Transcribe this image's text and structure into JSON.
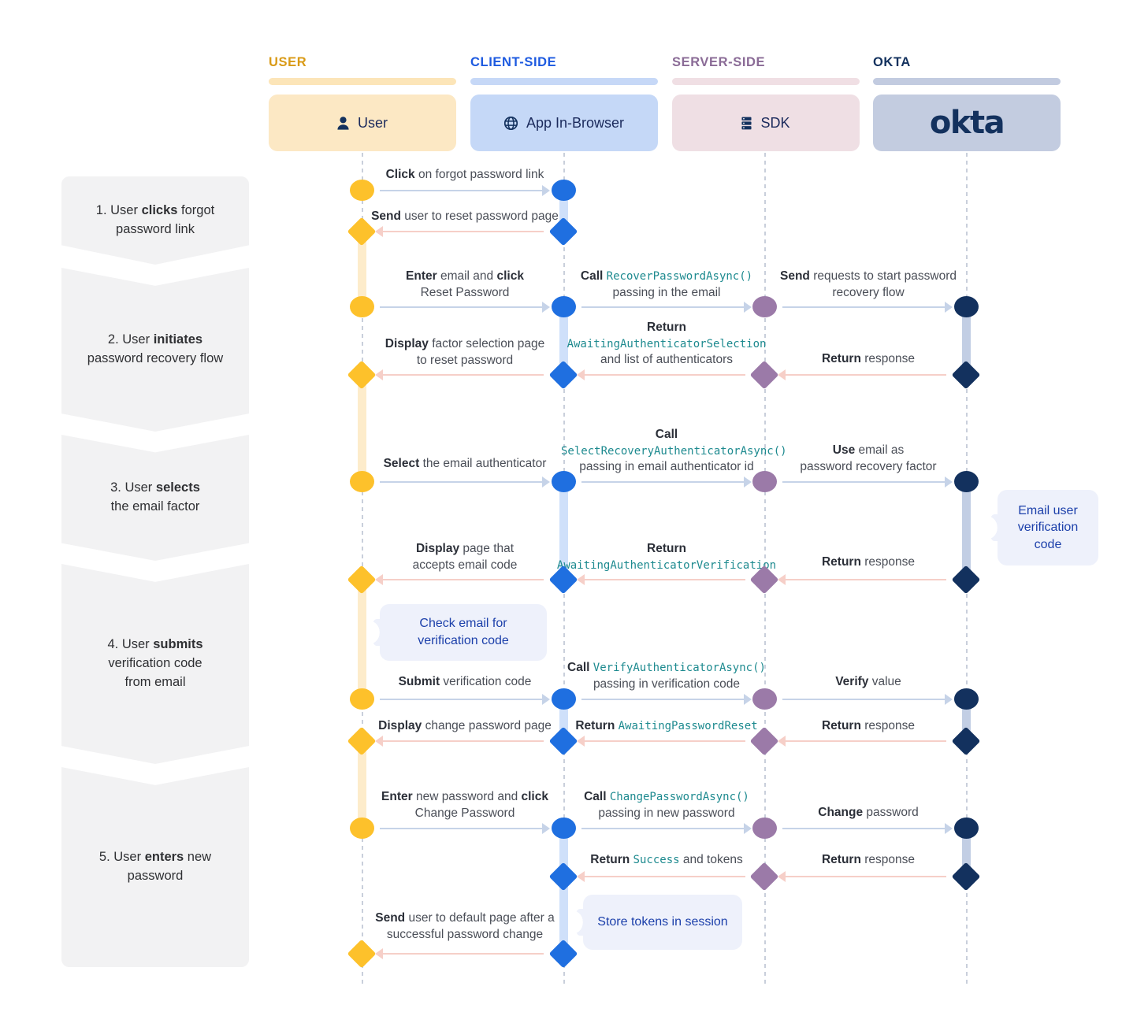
{
  "columns": [
    {
      "title": "USER",
      "title_color": "#d99a16",
      "bar_color": "#fce5b8",
      "box_color": "#fce8c4",
      "actor_label": "User",
      "icon": "person-icon"
    },
    {
      "title": "CLIENT-SIDE",
      "title_color": "#1d5ae0",
      "bar_color": "#c6d8f7",
      "box_color": "#c5d8f7",
      "actor_label": "App In-Browser",
      "icon": "globe-icon"
    },
    {
      "title": "SERVER-SIDE",
      "title_color": "#8a6b96",
      "bar_color": "#f0dfe4",
      "box_color": "#efdfe4",
      "actor_label": "SDK",
      "icon": "server-icon"
    },
    {
      "title": "OKTA",
      "title_color": "#13315e",
      "bar_color": "#c2cbe0",
      "box_color": "#c3cce0",
      "actor_label": "okta",
      "icon": "okta-logo"
    }
  ],
  "steps": [
    {
      "num": "1.",
      "text_html": "1. User <b>clicks</b> forgot<br>password link"
    },
    {
      "num": "2.",
      "text_html": "2. User <b>initiates</b><br>password recovery flow"
    },
    {
      "num": "3.",
      "text_html": "3. User <b>selects</b><br>the email factor"
    },
    {
      "num": "4.",
      "text_html": "4. User <b>submits</b><br>verification code<br>from email"
    },
    {
      "num": "5.",
      "text_html": "5. User <b>enters</b> new<br>password"
    }
  ],
  "messages": [
    {
      "id": "m1",
      "html": "<b>Click</b> on forgot password link"
    },
    {
      "id": "m2",
      "html": "<b>Send</b> user to reset password page"
    },
    {
      "id": "m3",
      "html": "<b>Enter</b> email and <b>click</b><br>Reset Password"
    },
    {
      "id": "m4",
      "html": "<b>Call</b> <span class=\"code\">RecoverPasswordAsync()</span><br>passing in the email"
    },
    {
      "id": "m5",
      "html": "<b>Send</b> requests to start password<br>recovery flow"
    },
    {
      "id": "m6",
      "html": "<b>Display</b> factor selection page<br>to reset password"
    },
    {
      "id": "m7",
      "html": "<b>Return</b><br><span class=\"code\">AwaitingAuthenticatorSelection</span><br>and list of authenticators"
    },
    {
      "id": "m8",
      "html": "<b>Return</b> response"
    },
    {
      "id": "m9",
      "html": "<b>Select</b> the email authenticator"
    },
    {
      "id": "m10",
      "html": "<b>Call</b><br><span class=\"code\">SelectRecoveryAuthenticatorAsync()</span><br>passing in email authenticator id"
    },
    {
      "id": "m11",
      "html": "<b>Use</b> email as<br>password recovery factor"
    },
    {
      "id": "m12",
      "html": "<b>Display</b> page that<br>accepts email code"
    },
    {
      "id": "m13",
      "html": "<b>Return</b><br><span class=\"code\">AwaitingAuthenticatorVerification</span>"
    },
    {
      "id": "m14",
      "html": "<b>Return</b> response"
    },
    {
      "id": "m15",
      "html": "<b>Submit</b> verification code"
    },
    {
      "id": "m16",
      "html": "<b>Call</b> <span class=\"code\">VerifyAuthenticatorAsync()</span><br>passing in verification code"
    },
    {
      "id": "m17",
      "html": "<b>Verify</b> value"
    },
    {
      "id": "m18",
      "html": "<b>Display</b> change password page"
    },
    {
      "id": "m19",
      "html": "<b>Return</b> <span class=\"code\">AwaitingPasswordReset</span>"
    },
    {
      "id": "m20",
      "html": "<b>Return</b> response"
    },
    {
      "id": "m21",
      "html": "<b>Enter</b> new password and <b>click</b><br>Change Password"
    },
    {
      "id": "m22",
      "html": "<b>Call</b> <span class=\"code\">ChangePasswordAsync()</span><br>passing in new password"
    },
    {
      "id": "m23",
      "html": "<b>Change</b> password"
    },
    {
      "id": "m24",
      "html": "<b>Return</b> <span class=\"code\">Success</span> and tokens"
    },
    {
      "id": "m25",
      "html": "<b>Return</b> response"
    },
    {
      "id": "m26",
      "html": "<b>Send</b> user to default page after a<br>successful password change"
    }
  ],
  "callouts": [
    {
      "id": "c1",
      "text": "Email user verification code"
    },
    {
      "id": "c2",
      "text": "Check email for verification code"
    },
    {
      "id": "c3",
      "text": "Store tokens in session"
    }
  ],
  "colors": {
    "user": "#fdc12b",
    "client": "#1f6fe0",
    "server": "#9b7aa8",
    "okta": "#13315e",
    "forward_arrow": "#c6d3e8",
    "return_arrow": "#f6cfc8",
    "code_text": "#1d8a8f",
    "step_bg": "#f2f2f3",
    "callout_bg": "#eef1fb",
    "callout_text": "#1b3faa"
  },
  "chart_data": {
    "type": "sequence-diagram",
    "title": "Okta password recovery sequence",
    "lanes": [
      "User",
      "App In-Browser",
      "SDK",
      "okta"
    ],
    "lane_groups": [
      "USER",
      "CLIENT-SIDE",
      "SERVER-SIDE",
      "OKTA"
    ],
    "steps": 5,
    "message_count": 26,
    "callout_count": 3
  }
}
